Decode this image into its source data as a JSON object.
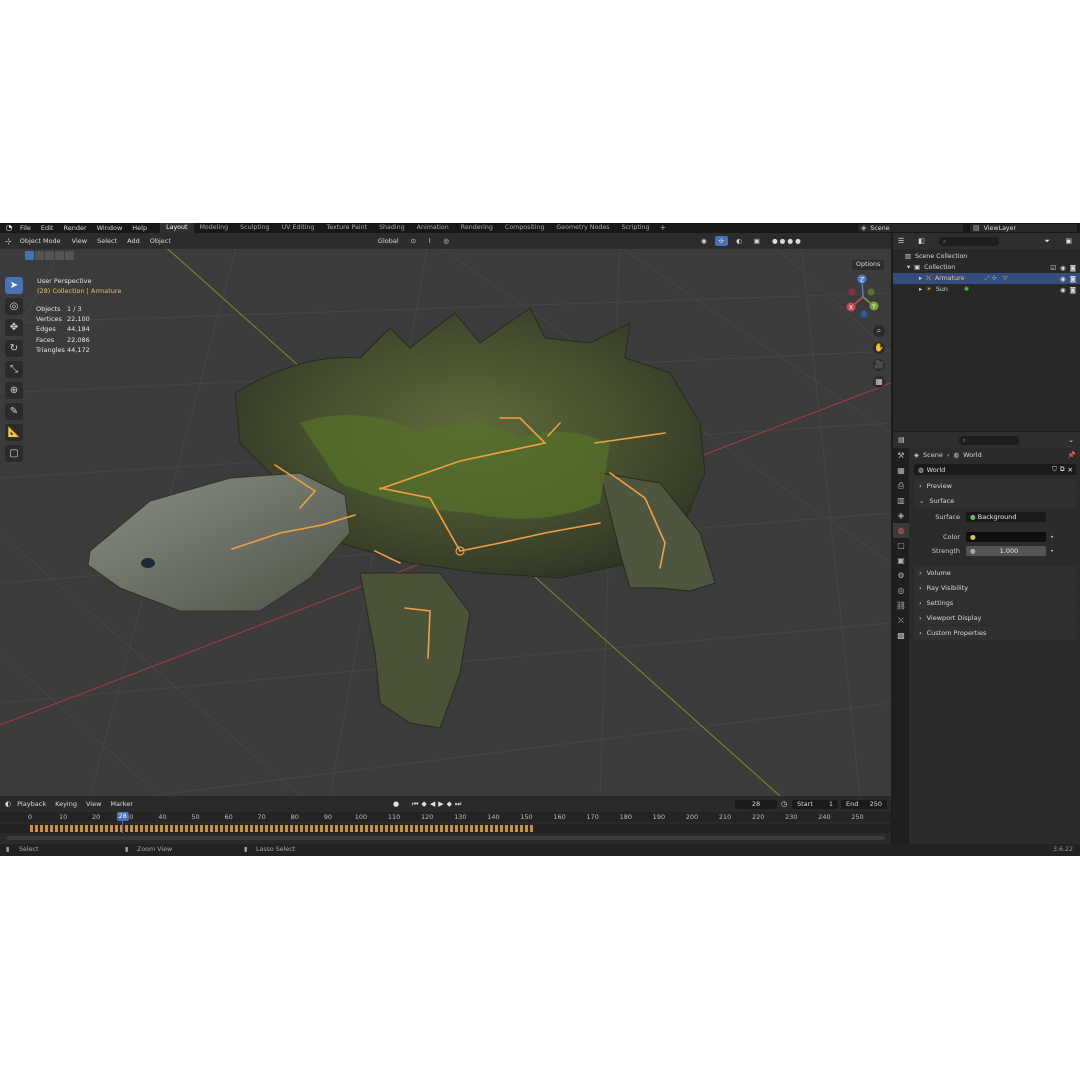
{
  "menubar": {
    "items": [
      "File",
      "Edit",
      "Render",
      "Window",
      "Help"
    ],
    "workspaces": [
      "Layout",
      "Modeling",
      "Sculpting",
      "UV Editing",
      "Texture Paint",
      "Shading",
      "Animation",
      "Rendering",
      "Compositing",
      "Geometry Nodes",
      "Scripting"
    ],
    "active_workspace": "Layout",
    "add_tab": "+",
    "scene": "Scene",
    "view_layer": "ViewLayer"
  },
  "viewport": {
    "mode": "Object Mode",
    "menus": [
      "View",
      "Select",
      "Add",
      "Object"
    ],
    "orientation": "Global",
    "perspective_label": "User Perspective",
    "collection_label": "(28) Collection | Armature",
    "options_label": "Options",
    "stats": [
      {
        "label": "Objects",
        "value": "1 / 3"
      },
      {
        "label": "Vertices",
        "value": "22,100"
      },
      {
        "label": "Edges",
        "value": "44,184"
      },
      {
        "label": "Faces",
        "value": "22,086"
      },
      {
        "label": "Triangles",
        "value": "44,172"
      }
    ],
    "gizmo": {
      "x": "X",
      "y": "Y",
      "z": "Z"
    }
  },
  "timeline": {
    "menus": [
      "Playback",
      "Keying",
      "View",
      "Marker"
    ],
    "current_frame": "28",
    "start_label": "Start",
    "start": "1",
    "end_label": "End",
    "end": "250",
    "ticks": [
      "0",
      "10",
      "20",
      "30",
      "40",
      "50",
      "60",
      "70",
      "80",
      "90",
      "100",
      "110",
      "120",
      "130",
      "140",
      "150",
      "160",
      "170",
      "180",
      "190",
      "200",
      "210",
      "220",
      "230",
      "240",
      "250"
    ]
  },
  "statusbar": {
    "select": "Select",
    "zoom": "Zoom View",
    "lasso": "Lasso Select",
    "version": "3.6.22"
  },
  "outliner": {
    "scene_collection": "Scene Collection",
    "collection": "Collection",
    "armature": "Armature",
    "sun": "Sun"
  },
  "properties": {
    "crumb_scene": "Scene",
    "crumb_world": "World",
    "world_name": "World",
    "sections": {
      "preview": "Preview",
      "surface": "Surface",
      "volume": "Volume",
      "ray_visibility": "Ray Visibility",
      "settings": "Settings",
      "viewport_display": "Viewport Display",
      "custom_properties": "Custom Properties"
    },
    "surface_label": "Surface",
    "surface_value": "Background",
    "color_label": "Color",
    "strength_label": "Strength",
    "strength_value": "1.000"
  },
  "colors": {
    "accent": "#4772b3",
    "bone": "#f0a040",
    "selected_row": "#334d80",
    "keyframe": "#e39a3a"
  }
}
